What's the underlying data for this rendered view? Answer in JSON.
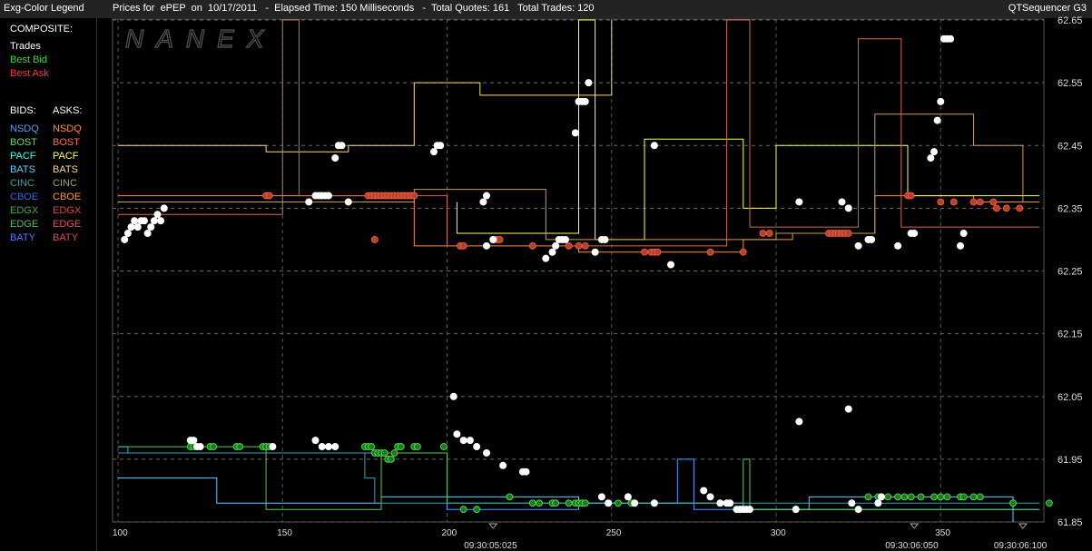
{
  "header": {
    "legend_title": "Exg-Color Legend",
    "title": "Prices for  ePEP  on  10/17/2011   -  Elapsed Time: 150 Milliseconds   -  Total Quotes: 161   Total Trades: 120",
    "app_name": "QTSequencer G3"
  },
  "legend": {
    "composite_label": "COMPOSITE:",
    "composite": [
      {
        "label": "Trades",
        "color": "#ffffff"
      },
      {
        "label": "Best Bid",
        "color": "#33dd33"
      },
      {
        "label": "Best Ask",
        "color": "#ff3333"
      }
    ],
    "bids_label": "BIDS:",
    "asks_label": "ASKS:",
    "exchanges": [
      {
        "bid": "NSDQ",
        "ask": "NSDQ",
        "bid_color": "#4aa0ff",
        "ask_color": "#ff8c3a"
      },
      {
        "bid": "BOST",
        "ask": "BOST",
        "bid_color": "#66dd66",
        "ask_color": "#ff6a5a"
      },
      {
        "bid": "PACF",
        "ask": "PACF",
        "bid_color": "#33ffee",
        "ask_color": "#ffff44"
      },
      {
        "bid": "BATS",
        "ask": "BATS",
        "bid_color": "#66ccff",
        "ask_color": "#ffdd88"
      },
      {
        "bid": "CINC",
        "ask": "CINC",
        "bid_color": "#3aa0a0",
        "ask_color": "#aaaa44"
      },
      {
        "bid": "CBOE",
        "ask": "CBOE",
        "bid_color": "#3366cc",
        "ask_color": "#ff9933"
      },
      {
        "bid": "EDGX",
        "ask": "EDGX",
        "bid_color": "#44aa44",
        "ask_color": "#dd4444"
      },
      {
        "bid": "EDGE",
        "ask": "EDGE",
        "bid_color": "#55bb55",
        "ask_color": "#dd5555"
      },
      {
        "bid": "BATY",
        "ask": "BATY",
        "bid_color": "#5577ff",
        "ask_color": "#ee4444"
      }
    ]
  },
  "watermark": "NANEX",
  "chart_data": {
    "type": "line",
    "ylim": [
      61.85,
      62.65
    ],
    "xlim": [
      100,
      380
    ],
    "y_ticks": [
      "62.65",
      "62.55",
      "62.45",
      "62.35",
      "62.25",
      "62.15",
      "62.05",
      "61.95",
      "61.85"
    ],
    "x_ticks": [
      "100",
      "150",
      "200",
      "250",
      "300",
      "350"
    ],
    "time_labels": [
      {
        "x": 214,
        "label": "09:30:05:025"
      },
      {
        "x": 342,
        "label": "09:30:06:050"
      },
      {
        "x": 375,
        "label": "09:30:06:100"
      }
    ],
    "grid": true,
    "trades": [
      [
        102,
        62.3
      ],
      [
        103,
        62.31
      ],
      [
        104,
        62.32
      ],
      [
        105,
        62.33
      ],
      [
        106,
        62.32
      ],
      [
        107,
        62.33
      ],
      [
        108,
        62.33
      ],
      [
        109,
        62.31
      ],
      [
        110,
        62.32
      ],
      [
        111,
        62.33
      ],
      [
        112,
        62.34
      ],
      [
        113,
        62.33
      ],
      [
        114,
        62.35
      ],
      [
        158,
        62.36
      ],
      [
        160,
        62.37
      ],
      [
        161,
        62.37
      ],
      [
        162,
        62.37
      ],
      [
        163,
        62.37
      ],
      [
        164,
        62.37
      ],
      [
        166,
        62.43
      ],
      [
        167,
        62.45
      ],
      [
        168,
        62.45
      ],
      [
        170,
        62.36
      ],
      [
        196,
        62.44
      ],
      [
        197,
        62.45
      ],
      [
        198,
        62.45
      ],
      [
        211,
        62.36
      ],
      [
        212,
        62.37
      ],
      [
        212,
        62.29
      ],
      [
        214,
        62.3
      ],
      [
        230,
        62.27
      ],
      [
        232,
        62.28
      ],
      [
        233,
        62.29
      ],
      [
        234,
        62.3
      ],
      [
        235,
        62.3
      ],
      [
        236,
        62.3
      ],
      [
        239,
        62.47
      ],
      [
        240,
        62.52
      ],
      [
        241,
        62.52
      ],
      [
        242,
        62.52
      ],
      [
        243,
        62.55
      ],
      [
        245,
        62.28
      ],
      [
        247,
        62.3
      ],
      [
        248,
        62.3
      ],
      [
        263,
        62.45
      ],
      [
        268,
        62.26
      ],
      [
        307,
        62.36
      ],
      [
        320,
        62.36
      ],
      [
        322,
        62.35
      ],
      [
        325,
        62.29
      ],
      [
        328,
        62.3
      ],
      [
        329,
        62.3
      ],
      [
        337,
        62.29
      ],
      [
        341,
        62.31
      ],
      [
        342,
        62.31
      ],
      [
        347,
        62.43
      ],
      [
        348,
        62.44
      ],
      [
        349,
        62.49
      ],
      [
        350,
        62.52
      ],
      [
        351,
        62.62
      ],
      [
        352,
        62.62
      ],
      [
        353,
        62.62
      ],
      [
        356,
        62.29
      ],
      [
        357,
        62.31
      ],
      [
        122,
        61.98
      ],
      [
        123,
        61.98
      ],
      [
        124,
        61.97
      ],
      [
        125,
        61.97
      ],
      [
        147,
        61.97
      ],
      [
        160,
        61.98
      ],
      [
        162,
        61.97
      ],
      [
        164,
        61.97
      ],
      [
        166,
        61.97
      ],
      [
        202,
        62.05
      ],
      [
        203,
        61.99
      ],
      [
        205,
        61.98
      ],
      [
        207,
        61.98
      ],
      [
        209,
        61.97
      ],
      [
        212,
        61.96
      ],
      [
        217,
        61.94
      ],
      [
        223,
        61.93
      ],
      [
        224,
        61.93
      ],
      [
        247,
        61.89
      ],
      [
        249,
        61.88
      ],
      [
        255,
        61.89
      ],
      [
        257,
        61.88
      ],
      [
        263,
        61.88
      ],
      [
        278,
        61.9
      ],
      [
        280,
        61.89
      ],
      [
        283,
        61.88
      ],
      [
        285,
        61.88
      ],
      [
        286,
        61.88
      ],
      [
        288,
        61.87
      ],
      [
        289,
        61.87
      ],
      [
        290,
        61.87
      ],
      [
        291,
        61.87
      ],
      [
        292,
        61.87
      ],
      [
        307,
        62.01
      ],
      [
        306,
        61.87
      ],
      [
        322,
        62.03
      ],
      [
        323,
        61.88
      ],
      [
        325,
        61.87
      ],
      [
        331,
        61.88
      ],
      [
        332,
        61.89
      ]
    ],
    "best_ask_points": [
      [
        145,
        62.37
      ],
      [
        146,
        62.37
      ],
      [
        176,
        62.37
      ],
      [
        177,
        62.37
      ],
      [
        178,
        62.37
      ],
      [
        179,
        62.37
      ],
      [
        180,
        62.37
      ],
      [
        181,
        62.37
      ],
      [
        182,
        62.37
      ],
      [
        183,
        62.37
      ],
      [
        184,
        62.37
      ],
      [
        185,
        62.37
      ],
      [
        186,
        62.37
      ],
      [
        187,
        62.37
      ],
      [
        188,
        62.37
      ],
      [
        189,
        62.37
      ],
      [
        190,
        62.37
      ],
      [
        178,
        62.3
      ],
      [
        204,
        62.29
      ],
      [
        205,
        62.29
      ],
      [
        214,
        62.3
      ],
      [
        215,
        62.3
      ],
      [
        216,
        62.3
      ],
      [
        226,
        62.29
      ],
      [
        237,
        62.29
      ],
      [
        240,
        62.29
      ],
      [
        242,
        62.29
      ],
      [
        260,
        62.28
      ],
      [
        262,
        62.28
      ],
      [
        263,
        62.28
      ],
      [
        264,
        62.28
      ],
      [
        280,
        62.28
      ],
      [
        290,
        62.28
      ],
      [
        296,
        62.31
      ],
      [
        298,
        62.31
      ],
      [
        316,
        62.31
      ],
      [
        317,
        62.31
      ],
      [
        318,
        62.31
      ],
      [
        319,
        62.31
      ],
      [
        320,
        62.31
      ],
      [
        321,
        62.31
      ],
      [
        322,
        62.31
      ],
      [
        340,
        62.37
      ],
      [
        341,
        62.37
      ],
      [
        350,
        62.36
      ],
      [
        354,
        62.36
      ],
      [
        360,
        62.36
      ],
      [
        362,
        62.36
      ],
      [
        366,
        62.36
      ],
      [
        367,
        62.35
      ],
      [
        370,
        62.35
      ],
      [
        374,
        62.35
      ]
    ],
    "best_bid_points": [
      [
        122,
        61.97
      ],
      [
        123,
        61.97
      ],
      [
        128,
        61.97
      ],
      [
        129,
        61.97
      ],
      [
        136,
        61.97
      ],
      [
        137,
        61.97
      ],
      [
        144,
        61.97
      ],
      [
        145,
        61.97
      ],
      [
        146,
        61.97
      ],
      [
        175,
        61.97
      ],
      [
        176,
        61.97
      ],
      [
        177,
        61.97
      ],
      [
        178,
        61.96
      ],
      [
        179,
        61.96
      ],
      [
        180,
        61.96
      ],
      [
        181,
        61.96
      ],
      [
        182,
        61.95
      ],
      [
        183,
        61.95
      ],
      [
        184,
        61.96
      ],
      [
        185,
        61.97
      ],
      [
        186,
        61.97
      ],
      [
        190,
        61.97
      ],
      [
        191,
        61.97
      ],
      [
        199,
        61.97
      ],
      [
        205,
        61.87
      ],
      [
        209,
        61.87
      ],
      [
        219,
        61.89
      ],
      [
        226,
        61.88
      ],
      [
        228,
        61.88
      ],
      [
        232,
        61.88
      ],
      [
        233,
        61.88
      ],
      [
        237,
        61.88
      ],
      [
        239,
        61.88
      ],
      [
        240,
        61.88
      ],
      [
        241,
        61.88
      ],
      [
        242,
        61.88
      ],
      [
        249,
        61.88
      ],
      [
        252,
        61.88
      ],
      [
        256,
        61.88
      ],
      [
        306,
        61.87
      ],
      [
        328,
        61.89
      ],
      [
        331,
        61.89
      ],
      [
        334,
        61.89
      ],
      [
        337,
        61.89
      ],
      [
        339,
        61.89
      ],
      [
        341,
        61.89
      ],
      [
        344,
        61.89
      ],
      [
        348,
        61.89
      ],
      [
        350,
        61.89
      ],
      [
        352,
        61.89
      ],
      [
        356,
        61.89
      ],
      [
        357,
        61.89
      ],
      [
        360,
        61.89
      ],
      [
        362,
        61.89
      ],
      [
        372,
        61.88
      ],
      [
        383,
        61.88
      ]
    ],
    "ask_series": [
      {
        "color": "#ffdd66",
        "points": [
          [
            100,
            62.45
          ],
          [
            145,
            62.45
          ],
          [
            145,
            62.44
          ],
          [
            170,
            62.44
          ],
          [
            170,
            62.45
          ],
          [
            190,
            62.45
          ],
          [
            190,
            62.55
          ],
          [
            210,
            62.55
          ],
          [
            210,
            62.53
          ],
          [
            250,
            62.53
          ],
          [
            250,
            62.65
          ]
        ]
      },
      {
        "color": "#ff8c3a",
        "points": [
          [
            100,
            62.37
          ],
          [
            140,
            62.37
          ],
          [
            140,
            62.37
          ],
          [
            190,
            62.37
          ],
          [
            190,
            62.29
          ],
          [
            240,
            62.29
          ],
          [
            240,
            62.28
          ],
          [
            290,
            62.28
          ],
          [
            290,
            62.3
          ],
          [
            305,
            62.3
          ],
          [
            305,
            62.31
          ],
          [
            330,
            62.31
          ],
          [
            330,
            62.37
          ],
          [
            360,
            62.37
          ],
          [
            360,
            62.36
          ],
          [
            380,
            62.36
          ]
        ]
      },
      {
        "color": "#ffff44",
        "points": [
          [
            203,
            62.36
          ],
          [
            203,
            62.31
          ],
          [
            240,
            62.31
          ],
          [
            240,
            62.65
          ],
          [
            245,
            62.65
          ],
          [
            245,
            62.3
          ],
          [
            260,
            62.3
          ],
          [
            260,
            62.46
          ],
          [
            290,
            62.46
          ],
          [
            290,
            62.35
          ],
          [
            300,
            62.35
          ],
          [
            300,
            62.45
          ],
          [
            340,
            62.45
          ],
          [
            340,
            62.37
          ],
          [
            380,
            62.37
          ]
        ]
      },
      {
        "color": "#d26a4a",
        "points": [
          [
            100,
            62.34
          ],
          [
            150,
            62.34
          ],
          [
            150,
            62.65
          ],
          [
            155,
            62.65
          ],
          [
            155,
            62.37
          ],
          [
            200,
            62.37
          ],
          [
            200,
            62.29
          ],
          [
            285,
            62.29
          ],
          [
            285,
            62.65
          ],
          [
            292,
            62.65
          ],
          [
            292,
            62.32
          ],
          [
            325,
            62.32
          ],
          [
            325,
            62.62
          ],
          [
            338,
            62.62
          ],
          [
            338,
            62.32
          ],
          [
            380,
            62.32
          ]
        ]
      },
      {
        "color": "#c8a050",
        "points": [
          [
            100,
            62.36
          ],
          [
            135,
            62.36
          ],
          [
            135,
            62.36
          ],
          [
            190,
            62.36
          ],
          [
            190,
            62.38
          ],
          [
            230,
            62.38
          ],
          [
            230,
            62.3
          ],
          [
            300,
            62.3
          ],
          [
            300,
            62.31
          ],
          [
            330,
            62.31
          ],
          [
            330,
            62.5
          ],
          [
            360,
            62.5
          ],
          [
            360,
            62.45
          ],
          [
            375,
            62.45
          ],
          [
            375,
            62.36
          ],
          [
            380,
            62.36
          ]
        ]
      }
    ],
    "bid_series": [
      {
        "color": "#4aa0ff",
        "points": [
          [
            100,
            61.97
          ],
          [
            103,
            61.97
          ],
          [
            103,
            61.96
          ],
          [
            200,
            61.96
          ],
          [
            200,
            61.87
          ],
          [
            240,
            61.87
          ],
          [
            240,
            61.88
          ],
          [
            270,
            61.88
          ],
          [
            270,
            61.95
          ],
          [
            275,
            61.95
          ],
          [
            275,
            61.87
          ],
          [
            380,
            61.87
          ]
        ]
      },
      {
        "color": "#66ccff",
        "points": [
          [
            100,
            61.92
          ],
          [
            130,
            61.92
          ],
          [
            130,
            61.88
          ],
          [
            180,
            61.88
          ],
          [
            180,
            61.89
          ],
          [
            240,
            61.89
          ],
          [
            240,
            61.88
          ],
          [
            290,
            61.88
          ],
          [
            290,
            61.87
          ],
          [
            310,
            61.87
          ],
          [
            310,
            61.89
          ],
          [
            372,
            61.89
          ],
          [
            372,
            61.85
          ]
        ]
      },
      {
        "color": "#55cc55",
        "points": [
          [
            100,
            61.97
          ],
          [
            145,
            61.97
          ],
          [
            145,
            61.87
          ],
          [
            180,
            61.87
          ],
          [
            180,
            61.96
          ],
          [
            200,
            61.96
          ],
          [
            200,
            61.88
          ],
          [
            290,
            61.88
          ],
          [
            290,
            61.95
          ],
          [
            292,
            61.95
          ],
          [
            292,
            61.87
          ],
          [
            380,
            61.87
          ]
        ]
      },
      {
        "color": "#3aa0c0",
        "points": [
          [
            100,
            61.96
          ],
          [
            175,
            61.96
          ],
          [
            175,
            61.92
          ],
          [
            178,
            61.92
          ],
          [
            178,
            61.88
          ],
          [
            380,
            61.88
          ]
        ]
      }
    ]
  }
}
